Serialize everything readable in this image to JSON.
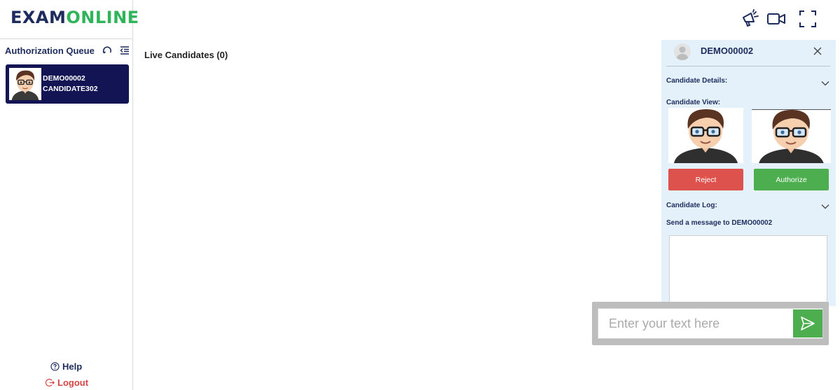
{
  "brand": {
    "part1": "EXAM",
    "part2": "ONLINE"
  },
  "sidebar": {
    "queue_title": "Authorization Queue",
    "candidates": [
      {
        "id": "DEMO00002",
        "name": "CANDIDATE302"
      }
    ],
    "help_label": "Help",
    "logout_label": "Logout"
  },
  "main": {
    "live_title": "Live Candidates (0)"
  },
  "panel": {
    "candidate_id": "DEMO00002",
    "details_label": "Candidate Details:",
    "view_label": "Candidate View:",
    "reject_label": "Reject",
    "authorize_label": "Authorize",
    "log_label": "Candidate Log:",
    "message_label": "Send a message to DEMO00002"
  },
  "chat": {
    "placeholder": "Enter your text here",
    "value": ""
  },
  "icons": {
    "topbar": [
      "announcement-icon",
      "video-camera-icon",
      "fullscreen-icon"
    ],
    "queue": [
      "refresh-icon",
      "list-menu-icon"
    ]
  },
  "colors": {
    "navy": "#1d2c5c",
    "brand_green": "#2fb45a",
    "card_bg": "#121454",
    "reject": "#dd524d",
    "authorize": "#4cae4f",
    "logout": "#d64545",
    "panel_bg": "#e4f1fb"
  }
}
